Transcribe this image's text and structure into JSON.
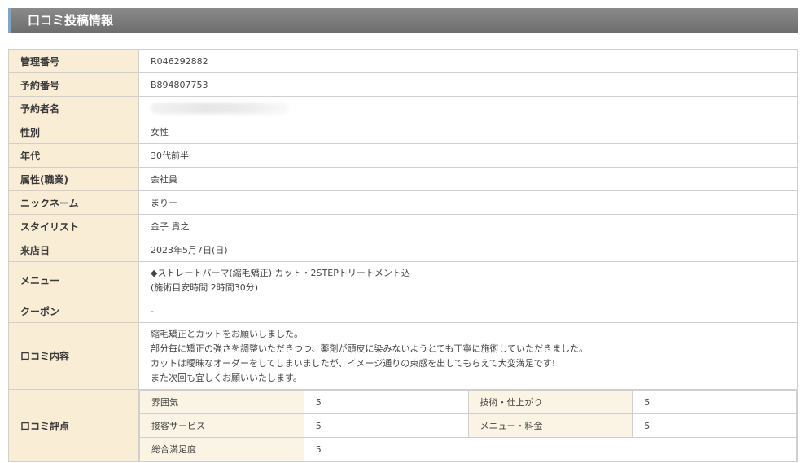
{
  "header": {
    "title": "口コミ投稿情報"
  },
  "rows": [
    {
      "label": "管理番号",
      "value": "R046292882"
    },
    {
      "label": "予約番号",
      "value": "B894807753"
    },
    {
      "label": "予約者名",
      "value": ""
    },
    {
      "label": "性別",
      "value": "女性"
    },
    {
      "label": "年代",
      "value": "30代前半"
    },
    {
      "label": "属性(職業)",
      "value": "会社員"
    },
    {
      "label": "ニックネーム",
      "value": "まりー"
    },
    {
      "label": "スタイリスト",
      "value": "金子 貴之"
    },
    {
      "label": "来店日",
      "value": "2023年5月7日(日)"
    }
  ],
  "menu": {
    "label": "メニュー",
    "line1": "◆ストレートパーマ(縮毛矯正) カット・2STEPトリートメント込",
    "line2": "(施術目安時間 2時間30分)"
  },
  "coupon": {
    "label": "クーポン",
    "value": "-"
  },
  "review": {
    "label": "口コミ内容",
    "lines": [
      "縮毛矯正とカットをお願いしました。",
      "部分毎に矯正の強さを調整いただきつつ、薬剤が頭皮に染みないようとても丁寧に施術していただきました。",
      "カットは曖昧なオーダーをしてしまいましたが、イメージ通りの束感を出してもらえて大変満足です!",
      "また次回も宜しくお願いいたします。"
    ]
  },
  "rating": {
    "label": "口コミ評点",
    "items": [
      {
        "label": "雰囲気",
        "value": "5"
      },
      {
        "label": "技術・仕上がり",
        "value": "5"
      },
      {
        "label": "接客サービス",
        "value": "5"
      },
      {
        "label": "メニュー・料金",
        "value": "5"
      },
      {
        "label": "総合満足度",
        "value": "5"
      }
    ]
  }
}
